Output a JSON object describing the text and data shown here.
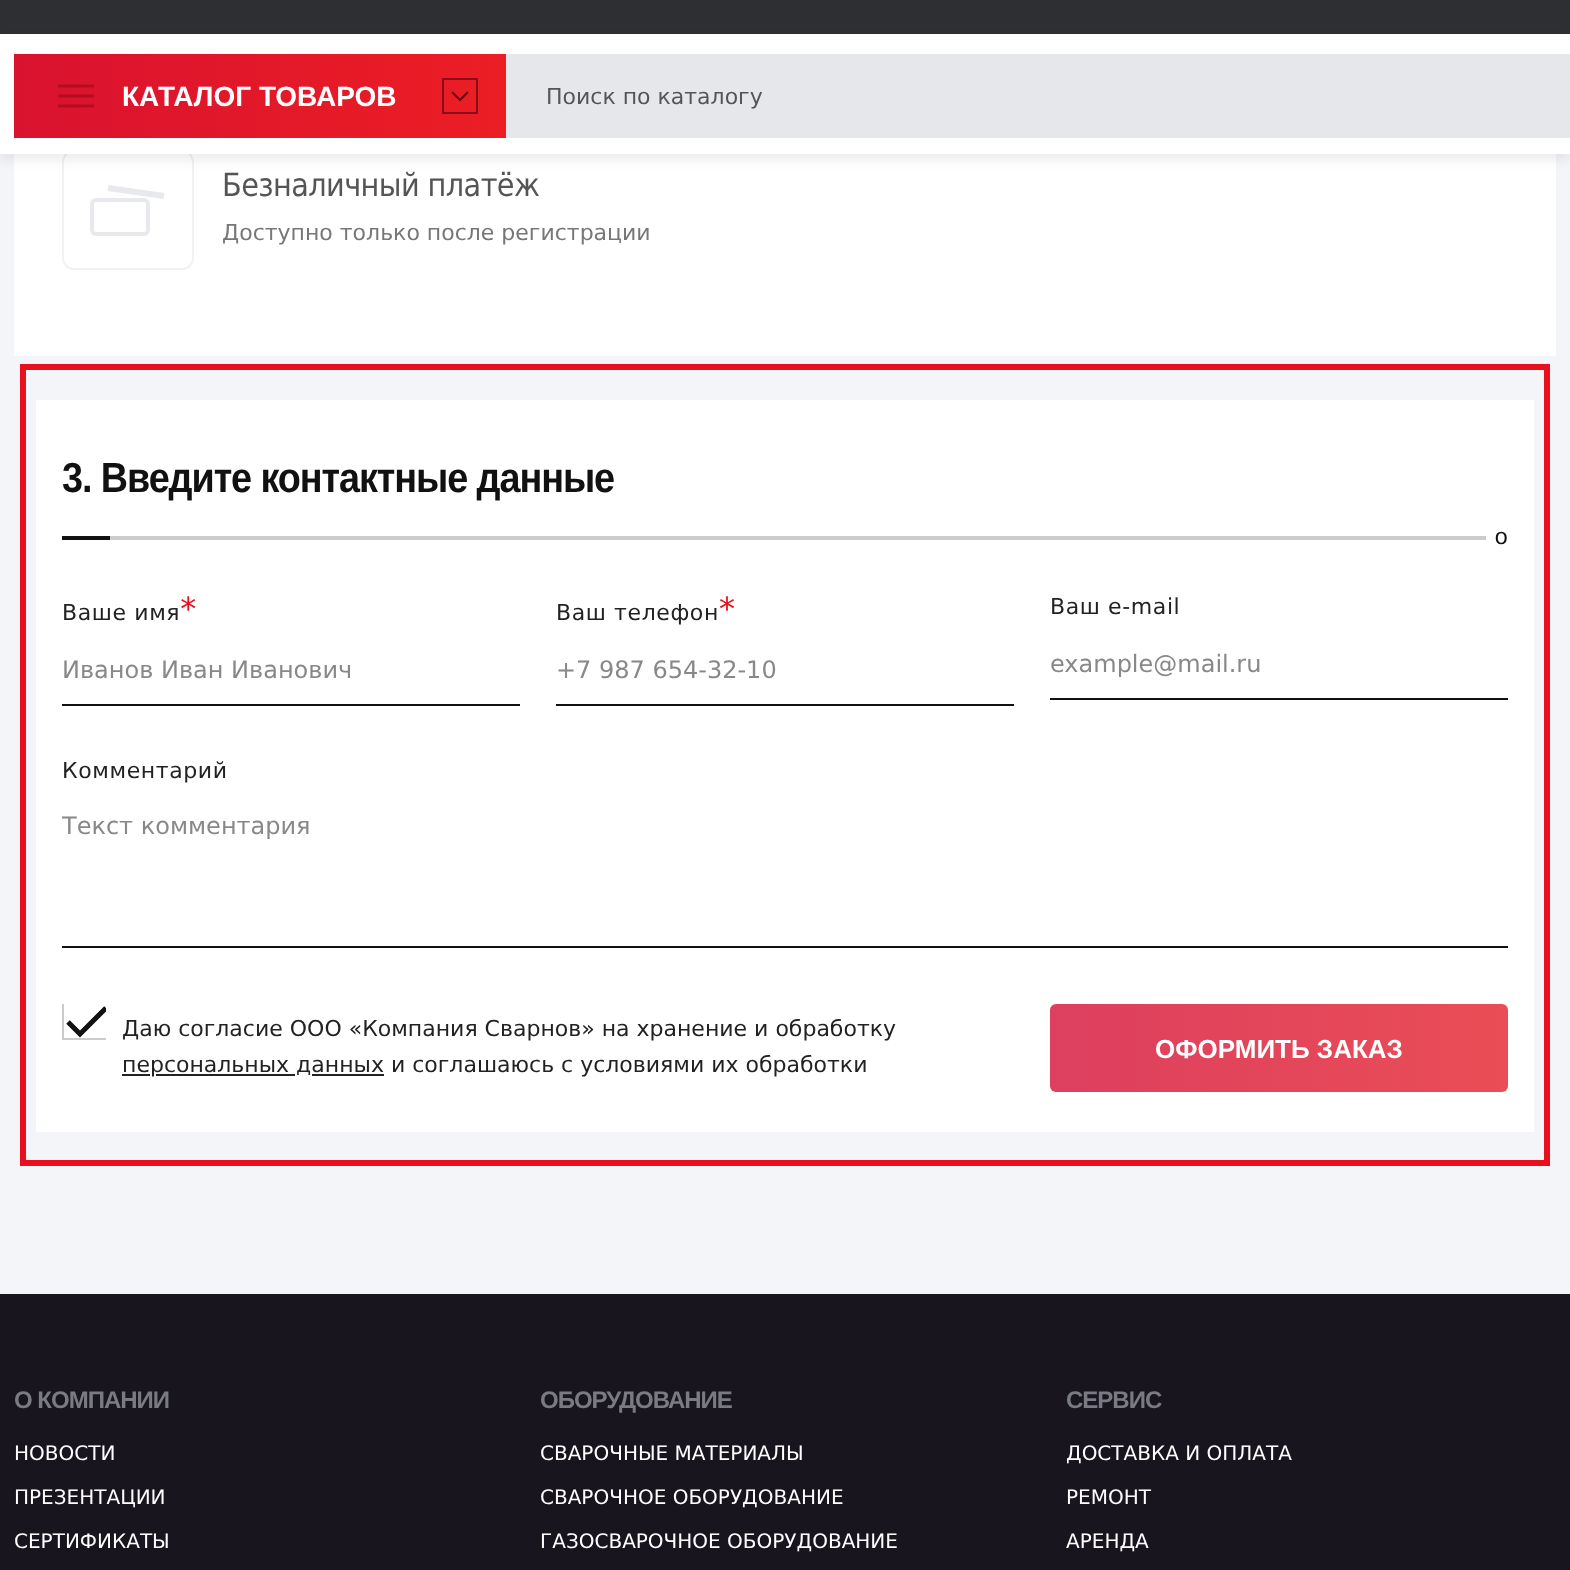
{
  "header": {
    "catalog_button": "КАТАЛОГ ТОВАРОВ",
    "search": {
      "placeholder": "Поиск по каталогу"
    }
  },
  "payment": {
    "title": "Безналичный платёж",
    "note": "Доступно только после регистрации"
  },
  "contact": {
    "title": "3. Введите контактные данные",
    "divider_mark": "o",
    "fields": [
      {
        "label": "Ваше имя",
        "required_mark": "*",
        "placeholder": "Иванов Иван Иванович"
      },
      {
        "label": "Ваш телефон",
        "required_mark": "*",
        "placeholder": "+7 987 654-32-10"
      },
      {
        "label": "Ваш e-mail",
        "placeholder": "example@mail.ru"
      }
    ],
    "comment": {
      "label": "Комментарий",
      "placeholder": "Текст комментария"
    },
    "consent": {
      "checked": true,
      "text_before": "Даю согласие ООО «Компания Сварнов» на хранение и обработку",
      "link": "персональных данных",
      "text_after": "и соглашаюсь с условиями их обработки"
    },
    "submit": "ОФОРМИТЬ ЗАКАЗ"
  },
  "footer": {
    "columns": [
      {
        "title": "О КОМПАНИИ",
        "links": [
          "НОВОСТИ",
          "ПРЕЗЕНТАЦИИ",
          "СЕРТИФИКАТЫ"
        ]
      },
      {
        "title": "ОБОРУДОВАНИЕ",
        "links": [
          "СВАРОЧНЫЕ МАТЕРИАЛЫ",
          "СВАРОЧНОЕ ОБОРУДОВАНИЕ",
          "ГАЗОСВАРОЧНОЕ ОБОРУДОВАНИЕ"
        ]
      },
      {
        "title": "СЕРВИС",
        "links": [
          "ДОСТАВКА И ОПЛАТА",
          "РЕМОНТ",
          "АРЕНДА"
        ]
      }
    ]
  }
}
